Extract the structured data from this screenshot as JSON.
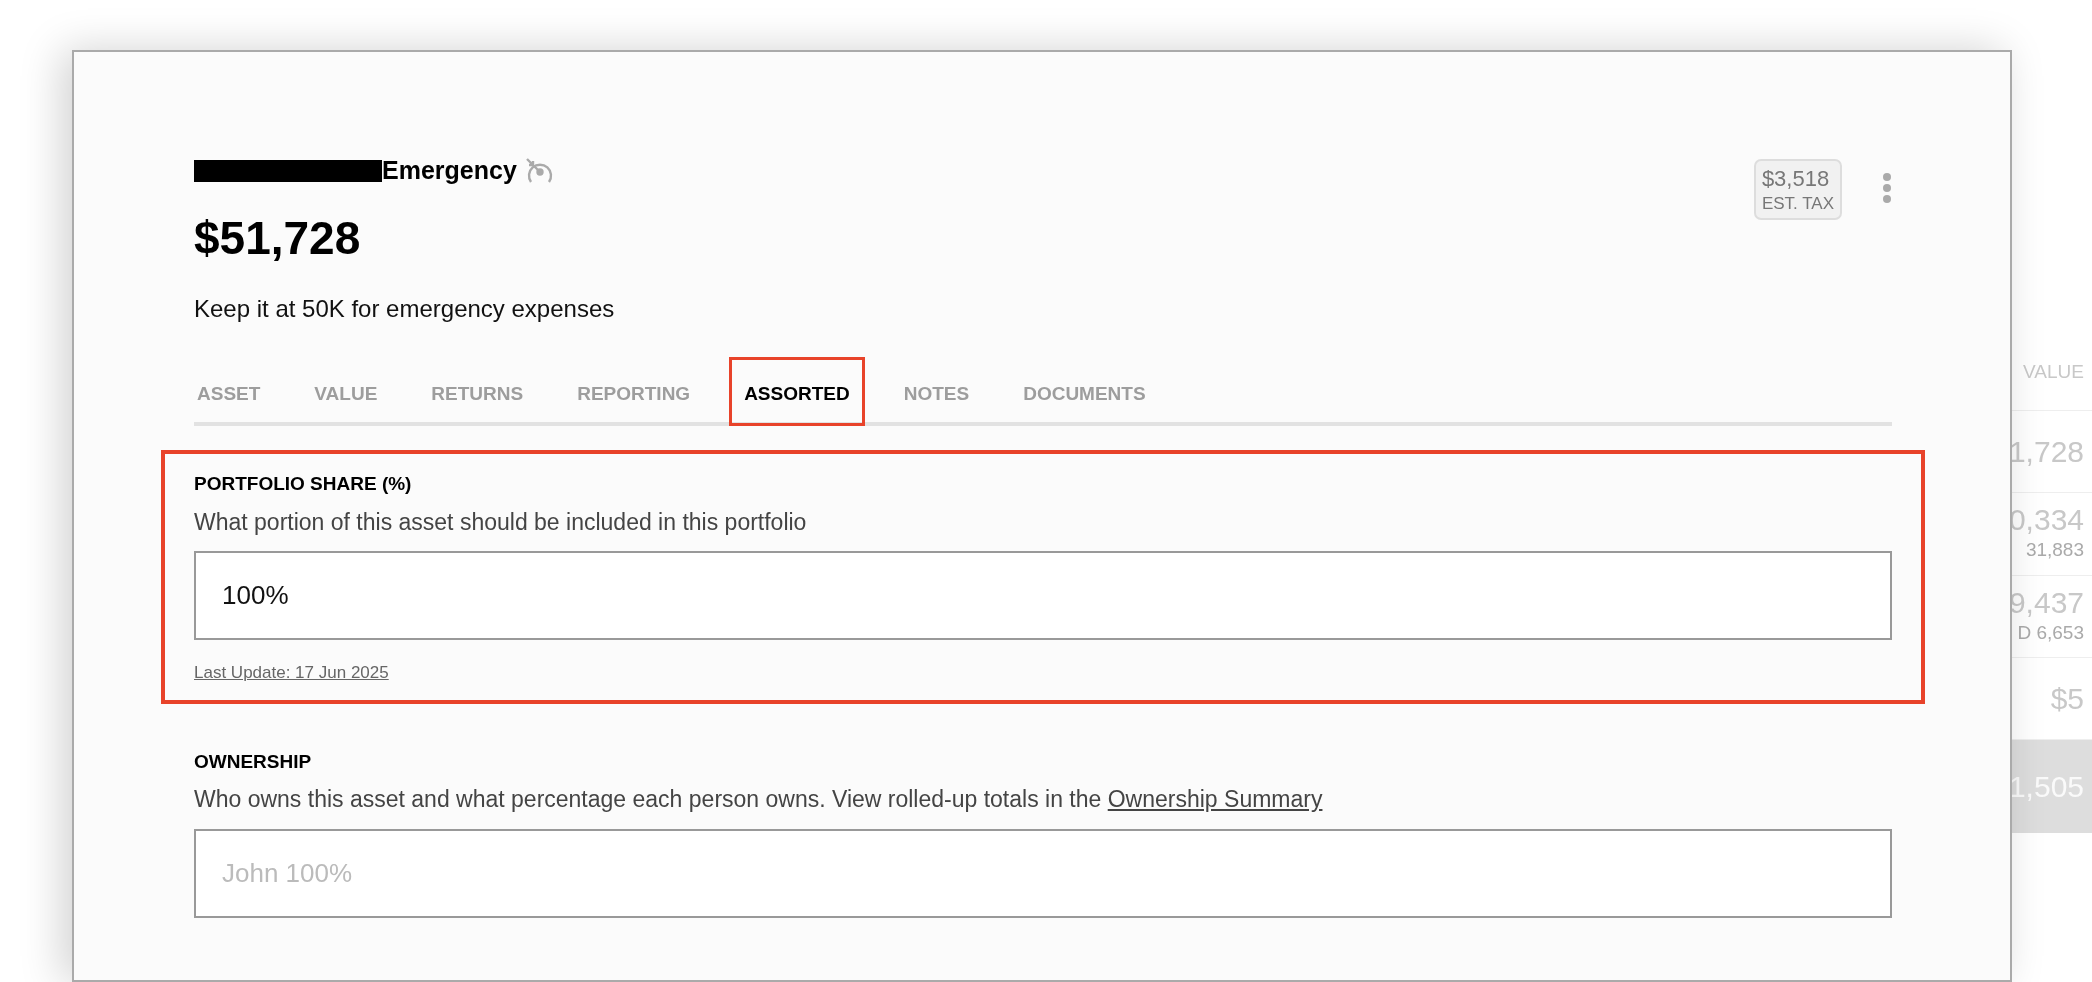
{
  "background_table": {
    "column_header": "VALUE",
    "rows": [
      {
        "kind": "row",
        "value": "1,728"
      },
      {
        "kind": "row",
        "value": "0,334",
        "sub": "31,883"
      },
      {
        "kind": "row",
        "value": "9,437",
        "sub": "D 6,653"
      },
      {
        "kind": "row",
        "value": "$5"
      },
      {
        "kind": "total",
        "value": "1,505"
      }
    ]
  },
  "modal": {
    "redacted_prefix": true,
    "title": "Emergency",
    "value": "$51,728",
    "description": "Keep it at 50K for emergency expenses",
    "tax": {
      "amount": "$3,518",
      "label": "EST. TAX"
    },
    "tabs": [
      {
        "label": "ASSET",
        "selected": false,
        "highlighted": false
      },
      {
        "label": "VALUE",
        "selected": false,
        "highlighted": false
      },
      {
        "label": "RETURNS",
        "selected": false,
        "highlighted": false
      },
      {
        "label": "REPORTING",
        "selected": false,
        "highlighted": false
      },
      {
        "label": "ASSORTED",
        "selected": true,
        "highlighted": true
      },
      {
        "label": "NOTES",
        "selected": false,
        "highlighted": false
      },
      {
        "label": "DOCUMENTS",
        "selected": false,
        "highlighted": false
      }
    ],
    "sections": [
      {
        "label": "PORTFOLIO SHARE (%)",
        "description": "What portion of this asset should be included in this portfolio",
        "value": "100%",
        "last_update": "Last Update: 17 Jun 2025",
        "highlighted": true
      },
      {
        "label": "OWNERSHIP",
        "description": "Who owns this asset and what percentage each person owns. View rolled-up totals in the",
        "link": "Ownership Summary",
        "placeholder": "John 100%",
        "highlighted": false
      }
    ]
  }
}
